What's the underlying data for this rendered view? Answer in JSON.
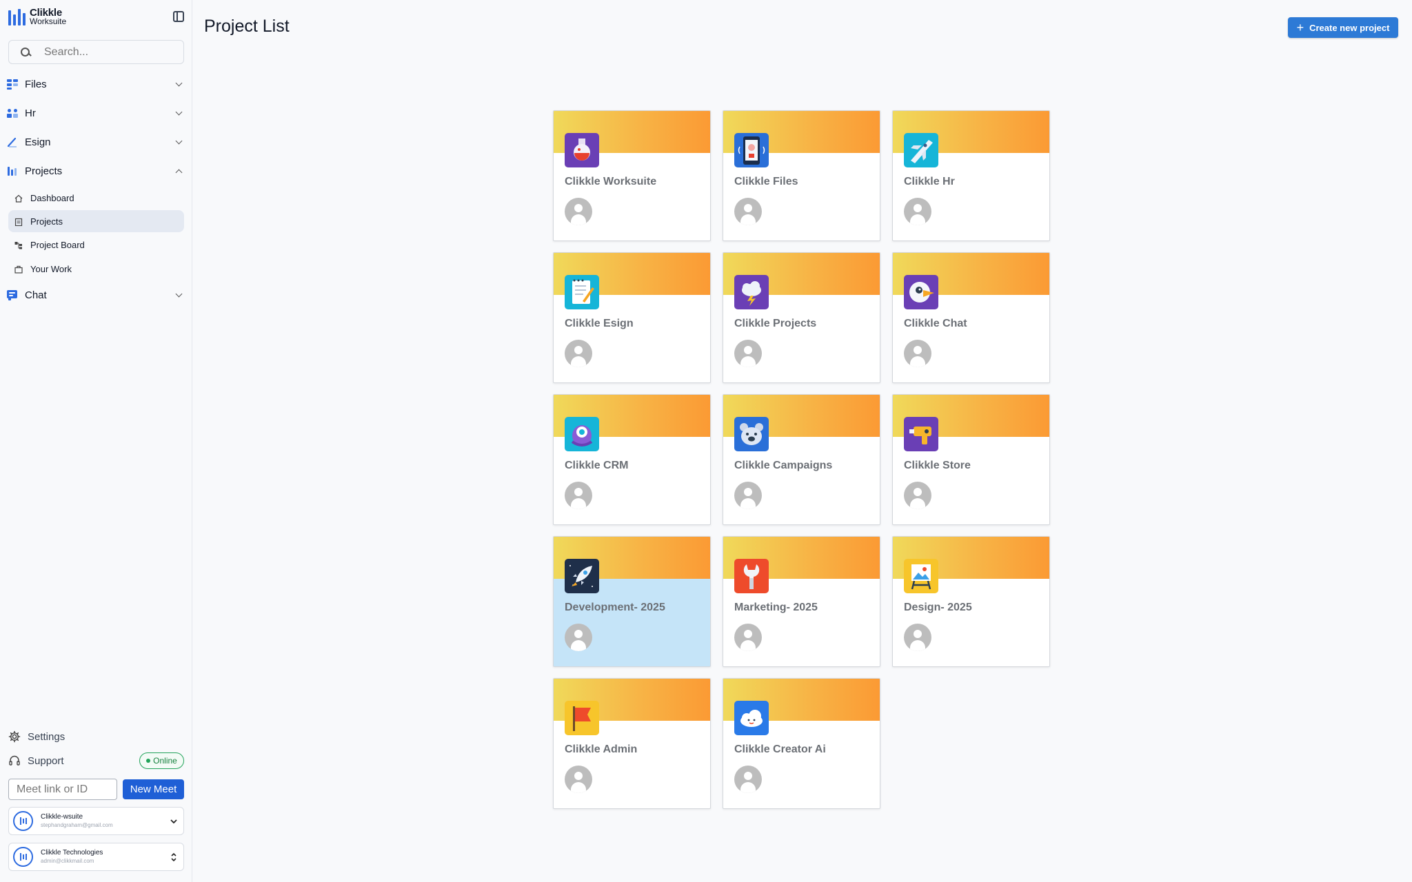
{
  "brand": {
    "name": "Clikkle",
    "product": "Worksuite"
  },
  "search": {
    "placeholder": "Search..."
  },
  "sidebar": {
    "sections": [
      {
        "label": "Files",
        "expanded": false
      },
      {
        "label": "Hr",
        "expanded": false
      },
      {
        "label": "Esign",
        "expanded": false
      },
      {
        "label": "Projects",
        "expanded": true
      },
      {
        "label": "Chat",
        "expanded": false
      }
    ],
    "project_items": [
      {
        "label": "Dashboard",
        "icon": "home-icon",
        "active": false
      },
      {
        "label": "Projects",
        "icon": "clipboard-icon",
        "active": true
      },
      {
        "label": "Project Board",
        "icon": "board-icon",
        "active": false
      },
      {
        "label": "Your Work",
        "icon": "briefcase-icon",
        "active": false
      }
    ],
    "settings_label": "Settings",
    "support_label": "Support",
    "status": "Online",
    "meet": {
      "placeholder": "Meet link or ID",
      "button": "New Meet"
    },
    "accounts": [
      {
        "name": "Clikkle-wsuite",
        "email": "stephandgraham@gmail.com"
      },
      {
        "name": "Clikkle Technologies",
        "email": "admin@clikkmail.com"
      }
    ]
  },
  "header": {
    "title": "Project List",
    "create_button": "Create new project"
  },
  "colors": {
    "accent": "#2d7ad6",
    "brand_blue": "#2d6be0",
    "banner_start": "#f0d95a",
    "banner_end": "#fb9a34",
    "selected_card": "#c5e4f8",
    "online": "#22a35a"
  },
  "projects": [
    {
      "name": "Clikkle Worksuite",
      "icon": "potion-icon",
      "selected": false
    },
    {
      "name": "Clikkle Files",
      "icon": "phone-icon",
      "selected": false
    },
    {
      "name": "Clikkle Hr",
      "icon": "rocket-plane-icon",
      "selected": false
    },
    {
      "name": "Clikkle Esign",
      "icon": "notepad-icon",
      "selected": false
    },
    {
      "name": "Clikkle Projects",
      "icon": "storm-cloud-icon",
      "selected": false
    },
    {
      "name": "Clikkle Chat",
      "icon": "bird-icon",
      "selected": false
    },
    {
      "name": "Clikkle CRM",
      "icon": "monster-icon",
      "selected": false
    },
    {
      "name": "Clikkle Campaigns",
      "icon": "bear-icon",
      "selected": false
    },
    {
      "name": "Clikkle Store",
      "icon": "blow-dryer-icon",
      "selected": false
    },
    {
      "name": "Development- 2025",
      "icon": "rocket-icon",
      "selected": true
    },
    {
      "name": "Marketing- 2025",
      "icon": "wrench-icon",
      "selected": false
    },
    {
      "name": "Design- 2025",
      "icon": "easel-icon",
      "selected": false
    },
    {
      "name": "Clikkle Admin",
      "icon": "flag-icon",
      "selected": false
    },
    {
      "name": "Clikkle Creator Ai",
      "icon": "cloud-icon",
      "selected": false
    }
  ]
}
